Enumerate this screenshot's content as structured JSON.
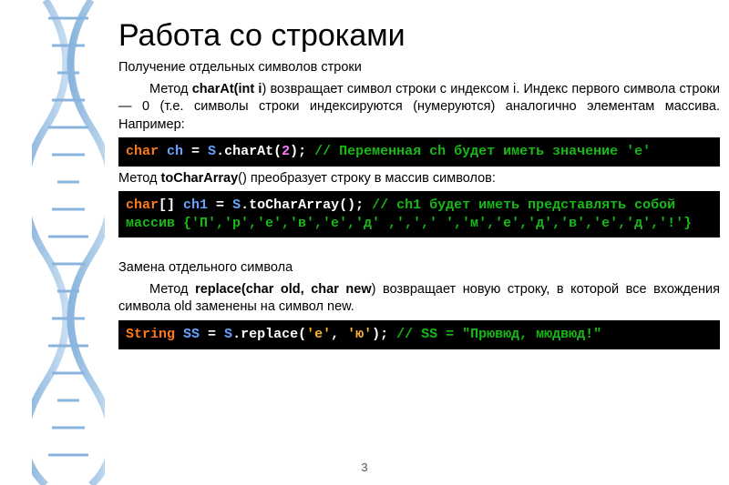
{
  "pageNumber": "3",
  "title": "Работа со строками",
  "section1": {
    "heading": "Получение отдельных символов строки",
    "text_a": "Метод ",
    "method": "charAt",
    "sig_open": "(",
    "sig_param": "int i",
    "text_b": ") возвращает символ строки с индексом i. Индекс первого символа строки — 0 (т.е. символы строки индексируются (нумеруются) аналогично элементам массива. Например:"
  },
  "code1": {
    "t1": "char",
    "t2": " ch ",
    "t3": "= ",
    "t4": "S",
    "t5": ".charAt(",
    "t6": "2",
    "t7": ");",
    "t8": " // Переменная ch будет иметь значение 'е'"
  },
  "section2": {
    "a": "Метод ",
    "m": "toCharArray",
    "b": "() преобразует строку в массив символов:"
  },
  "code2": {
    "t1": "char",
    "t2": "[] ",
    "t3": "ch1 ",
    "t4": "= ",
    "t5": "S",
    "t6": ".toCharArray();",
    "t7": " // ch1 будет иметь представлять собой массив {'П','р','е','в','е','д' ,',',' ','м','е','д','в','е','д','!'}"
  },
  "section3": {
    "heading": "Замена отдельного символа",
    "a": "Метод ",
    "m": "replace",
    "sig": "(char old, char new",
    "b": ") возвращает новую строку, в которой все вхождения символа old заменены на символ new."
  },
  "code3": {
    "t1": "String ",
    "t2": "SS ",
    "t3": "= ",
    "t4": "S",
    "t5": ".replace(",
    "t6": "'е'",
    "t7": ", ",
    "t8": "'ю'",
    "t9": ");",
    "t10": " // SS = \"Прювюд, мюдвюд!\""
  }
}
